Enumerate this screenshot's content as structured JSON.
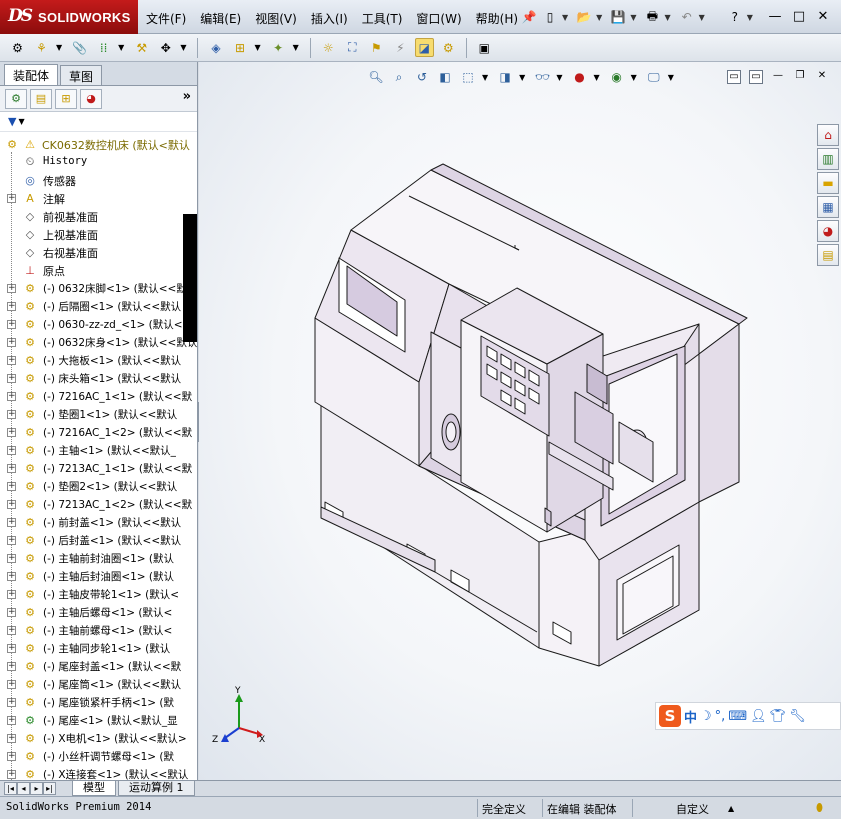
{
  "app": {
    "logo_mark": "DS",
    "logo_text": "SOLIDWORKS",
    "menu": [
      "文件(F)",
      "编辑(E)",
      "视图(V)",
      "插入(I)",
      "工具(T)",
      "窗口(W)",
      "帮助(H)"
    ],
    "window_buttons": [
      "—",
      "□",
      "✕"
    ]
  },
  "panel": {
    "tabs": [
      "装配体",
      "草图"
    ],
    "tree_root": "CK0632数控机床  (默认<默认",
    "ref_items": [
      {
        "label": "History",
        "icon": "history-icon"
      },
      {
        "label": "传感器",
        "icon": "sensor-icon"
      },
      {
        "label": "注解",
        "icon": "annotation-icon"
      },
      {
        "label": "前视基准面",
        "icon": "plane-icon"
      },
      {
        "label": "上视基准面",
        "icon": "plane-icon"
      },
      {
        "label": "右视基准面",
        "icon": "plane-icon"
      },
      {
        "label": "原点",
        "icon": "origin-icon"
      }
    ],
    "components": [
      "(-) 0632床脚<1> (默认<<默认",
      "(-) 后隔圈<1> (默认<<默认",
      "(-) 0630-zz-zd_<1> (默认<<",
      "(-) 0632床身<1> (默认<<默认",
      "(-) 大拖板<1> (默认<<默认",
      "(-) 床头箱<1> (默认<<默认",
      "(-) 7216AC_1<1> (默认<<默",
      "(-) 垫圈1<1> (默认<<默认",
      "(-) 7216AC_1<2> (默认<<默",
      "(-) 主轴<1> (默认<<默认_",
      "(-) 7213AC_1<1> (默认<<默",
      "(-) 垫圈2<1> (默认<<默认",
      "(-) 7213AC_1<2> (默认<<默",
      "(-) 前封盖<1> (默认<<默认",
      "(-) 后封盖<1> (默认<<默认",
      "(-) 主轴前封油圈<1> (默认",
      "(-) 主轴后封油圈<1> (默认",
      "(-) 主轴皮带轮1<1> (默认<",
      "(-) 主轴后螺母<1> (默认<",
      "(-) 主轴前螺母<1> (默认<",
      "(-) 主轴同步轮1<1> (默认",
      "(-) 尾座封盖<1> (默认<<默",
      "(-) 尾座筒<1> (默认<<默认",
      "(-) 尾座锁紧杆手柄<1> (默",
      "(-) 尾座<1> (默认<默认_显",
      "(-) X电机<1> (默认<<默认>",
      "(-) 小丝杆调节螺母<1> (默",
      "(-) X连接套<1> (默认<<默认"
    ]
  },
  "viewport": {
    "triad": {
      "x": "X",
      "y": "Y",
      "z": "Z"
    },
    "ime": {
      "logo": "S",
      "lang": "中"
    }
  },
  "bottom": {
    "tabs": [
      "模型",
      "运动算例 1"
    ]
  },
  "status": {
    "app_version": "SolidWorks Premium 2014",
    "fully_defined": "完全定义",
    "editing": "在编辑 装配体",
    "units": "自定义"
  },
  "colors": {
    "accent_red": "#b31515",
    "model_fill": "#f1eef4",
    "model_shade": "#dcd3e3",
    "model_dark": "#c2b6cc"
  }
}
